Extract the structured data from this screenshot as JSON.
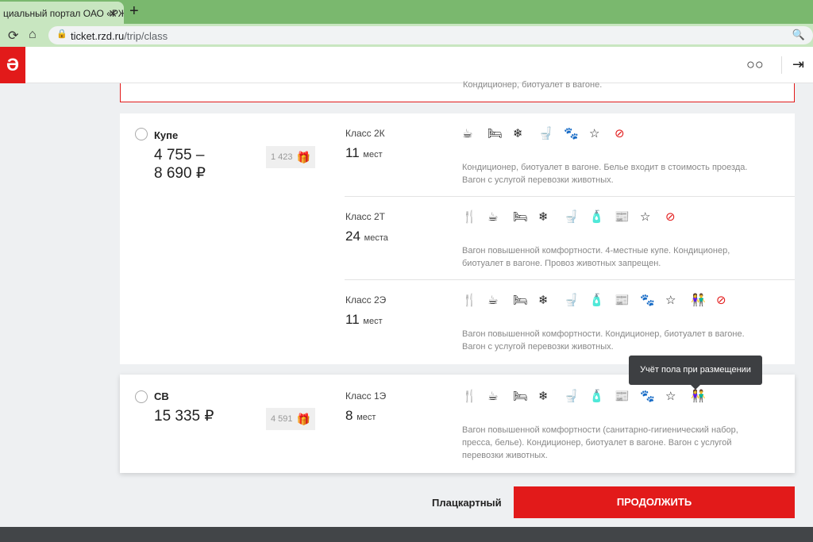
{
  "browser": {
    "tab_title": "циальный портал ОАО «РЖ",
    "tab_close": "✕",
    "new_tab": "+",
    "url_host": "ticket.rzd.ru",
    "url_path": "/trip/class"
  },
  "header": {
    "logo_text": "Ə"
  },
  "previous_card": {
    "desc_fragment": "Кондиционер, биотуалет в вагоне."
  },
  "categories": [
    {
      "name": "Купе",
      "price_line1": "4 755 –",
      "price_line2": "8 690 ₽",
      "bonus": "1 423",
      "classes": [
        {
          "label": "Класс 2К",
          "seats_num": "11",
          "seats_word": "мест",
          "desc_line1": "Кондиционер, биотуалет в вагоне. Белье входит в стоимость проезда.",
          "desc_line2": "Вагон с услугой перевозки животных."
        },
        {
          "label": "Класс 2Т",
          "seats_num": "24",
          "seats_word": "места",
          "desc_line1": "Вагон повышенной комфортности. 4-местные купе. Кондиционер,",
          "desc_line2": "биотуалет в вагоне. Провоз животных запрещен."
        },
        {
          "label": "Класс 2Э",
          "seats_num": "11",
          "seats_word": "мест",
          "desc_line1": "Вагон повышенной комфортности. Кондиционер, биотуалет в вагоне.",
          "desc_line2": "Вагон с услугой перевозки животных."
        }
      ]
    },
    {
      "name": "СВ",
      "price_line1": "15 335 ₽",
      "bonus": "4 591",
      "classes": [
        {
          "label": "Класс 1Э",
          "seats_num": "8",
          "seats_word": "мест",
          "desc_line1": "Вагон повышенной комфортности (санитарно-гигиенический набор,",
          "desc_line2": "пресса, белье). Кондиционер, биотуалет в вагоне. Вагон с услугой",
          "desc_line3": "перевозки животных."
        }
      ]
    }
  ],
  "tooltip": "Учёт пола при размещении",
  "footer_nav": {
    "platz_label": "Плацкартный",
    "continue_label": "ПРОДОЛЖИТЬ"
  },
  "colors": {
    "brand_red": "#e21a1a",
    "chrome_green": "#7ab86e"
  }
}
